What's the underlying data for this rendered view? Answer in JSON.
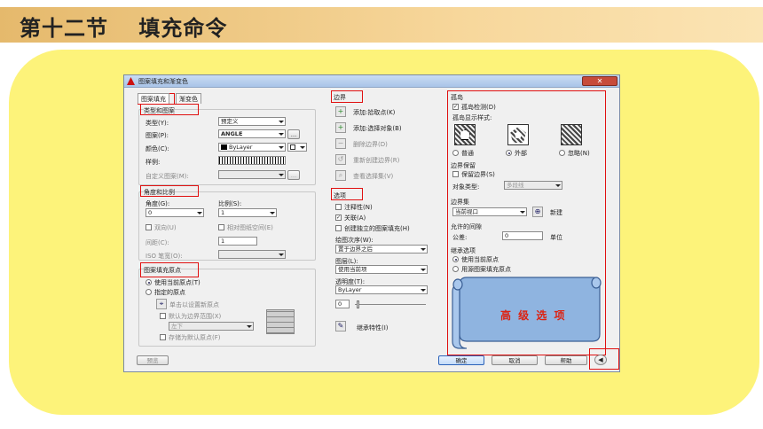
{
  "slide": {
    "title": "第十二节　 填充命令"
  },
  "dialog": {
    "title": "图案填充和渐变色",
    "tabs": [
      "图案填充",
      "渐变色"
    ],
    "hatch": {
      "type_group": "类型和图案",
      "type_label": "类型(Y):",
      "type_value": "预定义",
      "pattern_label": "图案(P):",
      "pattern_value": "ANGLE",
      "color_label": "颜色(C):",
      "color_value": "ByLayer",
      "sample_label": "样例:",
      "custom_label": "自定义图案(M):",
      "angle_group": "角度和比例",
      "angle_label": "角度(G):",
      "angle_value": "0",
      "scale_label": "比例(S):",
      "scale_value": "1",
      "double_label": "双向(U)",
      "relative_label": "相对图纸空间(E)",
      "spacing_label": "间距(C):",
      "spacing_value": "1",
      "iso_label": "ISO 笔宽(O):",
      "origin_group": "图案填充原点",
      "use_current_origin": "使用当前原点(T)",
      "specified_origin": "指定的原点",
      "click_set_origin": "单击以设置新原点",
      "default_extent": "默认为边界范围(X)",
      "position_value": "左下",
      "store_default": "存储为默认原点(F)"
    },
    "boundary": {
      "group": "边界",
      "add_pick": "添加:拾取点(K)",
      "add_select": "添加:选择对象(B)",
      "remove": "删除边界(D)",
      "recreate": "重新创建边界(R)",
      "view": "查看选择集(V)"
    },
    "options": {
      "group": "选项",
      "annotative": "注释性(N)",
      "associative": "关联(A)",
      "separate": "创建独立的图案填充(H)",
      "draw_order_label": "绘图次序(W):",
      "draw_order_value": "置于边界之后",
      "layer_label": "图层(L):",
      "layer_value": "使用当前项",
      "transparency_label": "透明度(T):",
      "transparency_value": "ByLayer",
      "transparency_num": "0",
      "inherit": "继承特性(I)"
    },
    "islands": {
      "group": "孤岛",
      "detect": "孤岛检测(D)",
      "display_style": "孤岛显示样式:",
      "styles": [
        "普通",
        "外部",
        "忽略(N)"
      ],
      "retain_group": "边界保留",
      "retain": "保留边界(S)",
      "object_type_label": "对象类型:",
      "object_type_value": "多段线",
      "boundary_set_group": "边界集",
      "boundary_set_value": "当前视口",
      "new_label": "新建",
      "gap_group": "允许的间隙",
      "tolerance_label": "公差:",
      "tolerance_value": "0",
      "unit_label": "单位",
      "inherit_group": "继承选项",
      "use_current": "使用当前原点",
      "use_source": "用源图案填充原点"
    },
    "advanced_label": "高 级 选 项",
    "buttons": {
      "preview": "预览",
      "ok": "确定",
      "cancel": "取消",
      "help": "帮助"
    }
  }
}
